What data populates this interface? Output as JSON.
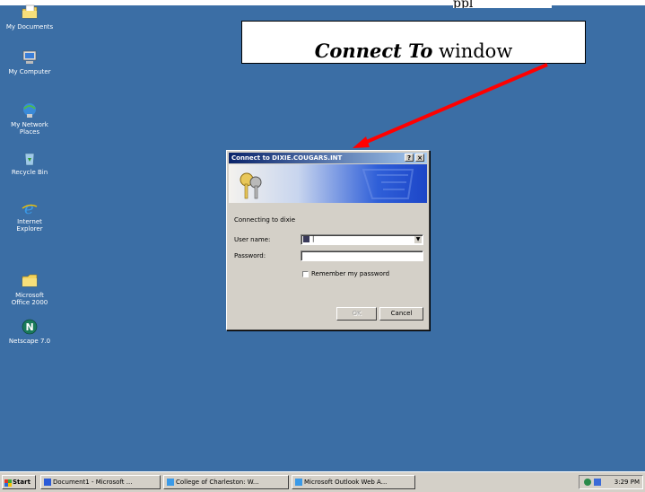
{
  "header_caption": "ppl",
  "annotation": {
    "em": "Connect To",
    "rest": " window"
  },
  "desktop_icons": [
    {
      "label_1": "My Documents",
      "label_2": "",
      "icon": "folder-documents-icon"
    },
    {
      "label_1": "My Computer",
      "label_2": "",
      "icon": "computer-icon"
    },
    {
      "label_1": "My Network",
      "label_2": "Places",
      "icon": "network-places-icon"
    },
    {
      "label_1": "Recycle Bin",
      "label_2": "",
      "icon": "recycle-bin-icon"
    },
    {
      "label_1": "Internet",
      "label_2": "Explorer",
      "icon": "internet-explorer-icon"
    },
    {
      "label_1": "Microsoft",
      "label_2": "Office 2000",
      "icon": "folder-icon"
    },
    {
      "label_1": "Netscape 7.0",
      "label_2": "",
      "icon": "netscape-icon"
    }
  ],
  "dialog": {
    "title": "Connect to DIXIE.COUGARS.INT",
    "help_btn": "?",
    "close_btn": "×",
    "connecting_text": "Connecting to dixie",
    "username_label": "User name:",
    "username_value": "|",
    "password_label": "Password:",
    "password_value": "",
    "remember_label": "Remember my password",
    "remember_checked": false,
    "ok_label": "OK",
    "ok_enabled": false,
    "cancel_label": "Cancel"
  },
  "taskbar": {
    "start_label": "Start",
    "items": [
      {
        "label": "Document1 - Microsoft ..."
      },
      {
        "label": "College of Charleston: W..."
      },
      {
        "label": "Microsoft Outlook Web A..."
      }
    ],
    "clock": "3:29 PM"
  },
  "colors": {
    "desktop": "#3b6ea5",
    "titlebar_start": "#0a246a",
    "arrow": "#ff0000"
  }
}
